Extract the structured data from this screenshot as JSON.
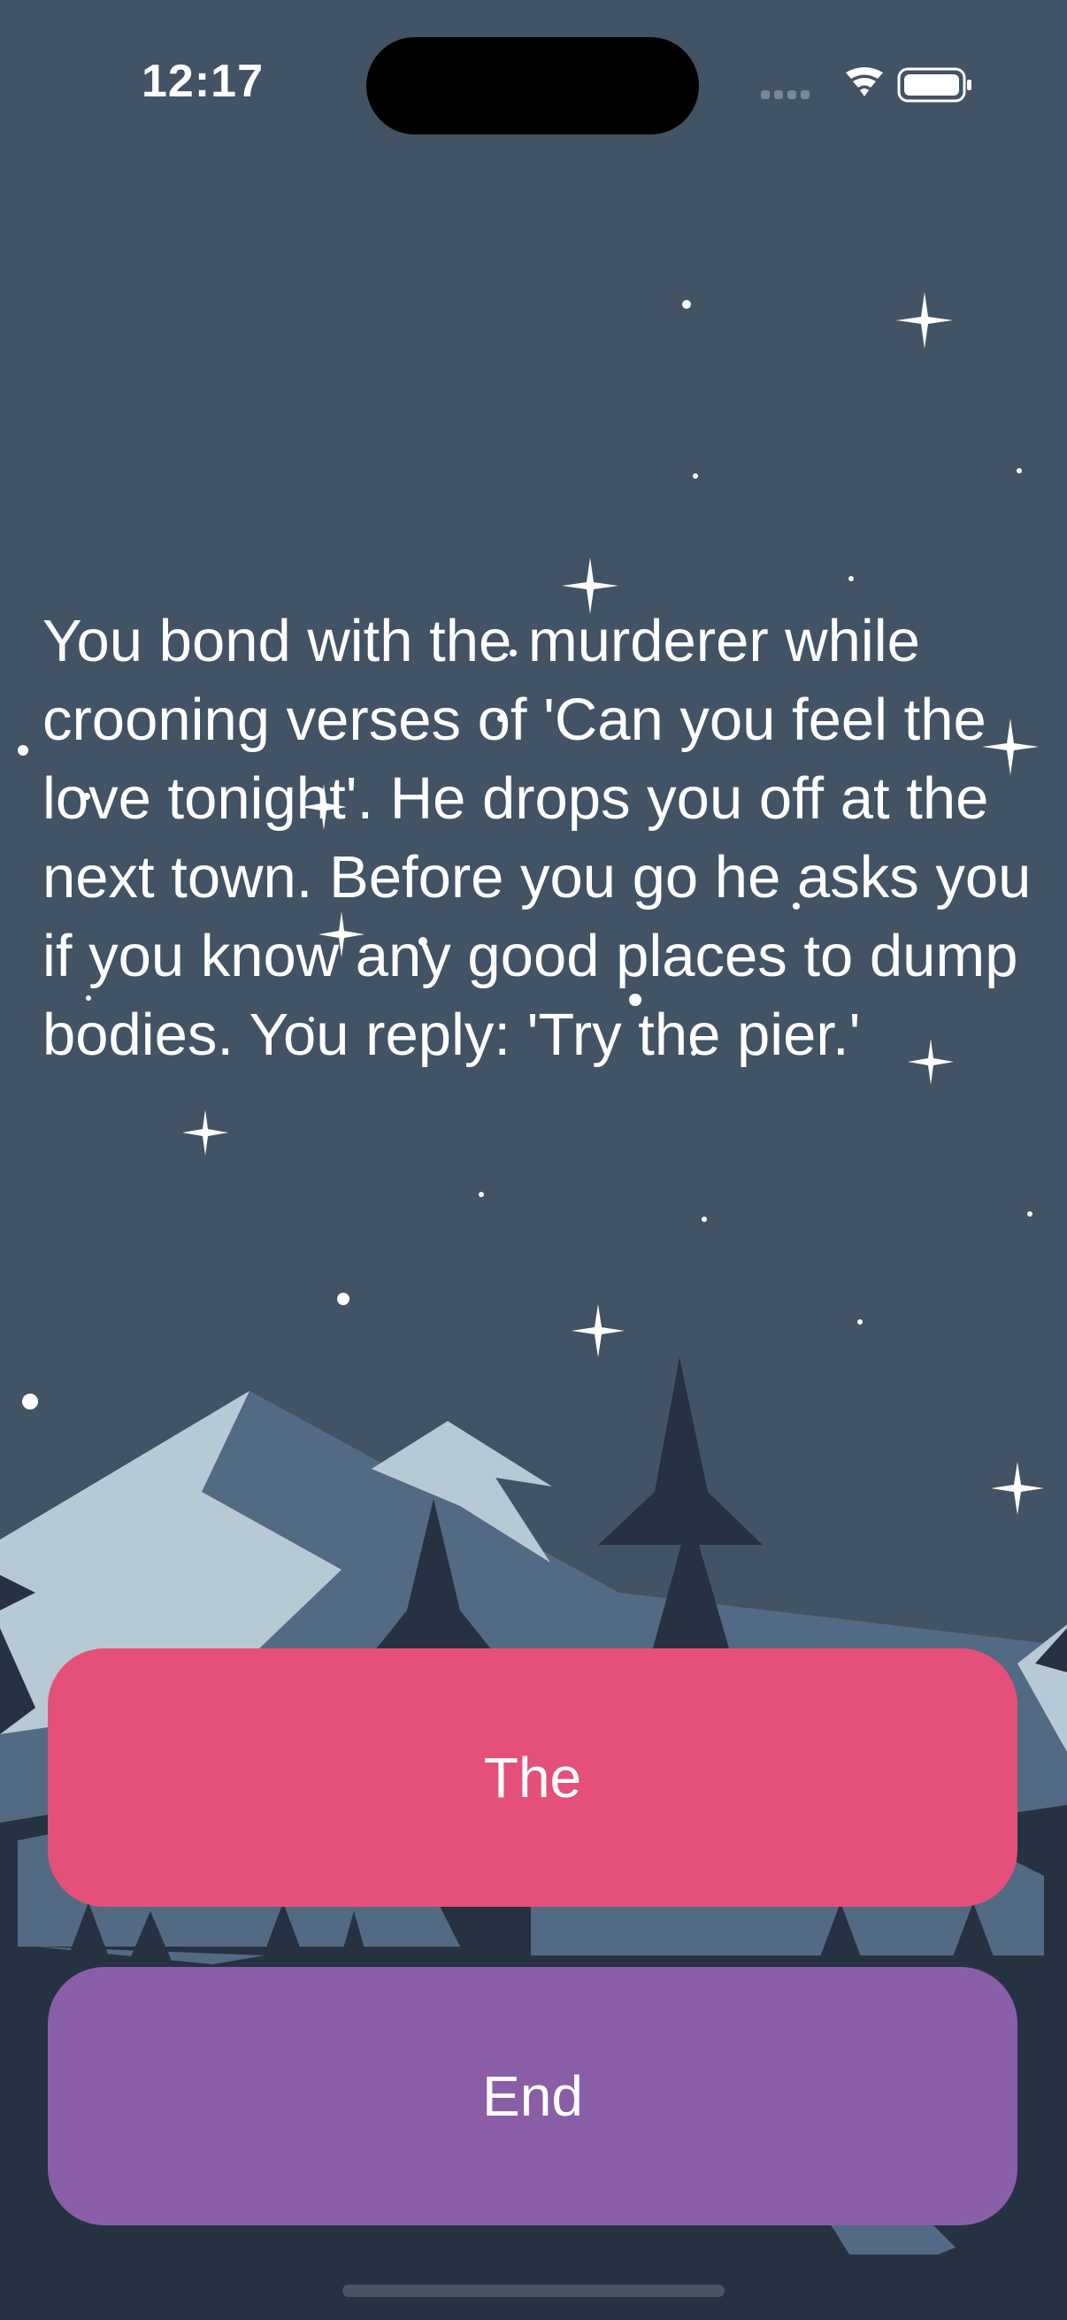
{
  "status_bar": {
    "time": "12:17",
    "icons": [
      "cellular-signal-icon",
      "wifi-icon",
      "battery-icon"
    ]
  },
  "story": {
    "text": "You bond with the murderer while crooning verses of 'Can you feel the love tonight'. He drops you off at the next town. Before you go he asks you if you know any good places to dump bodies. You reply: 'Try the pier.'"
  },
  "choices": [
    {
      "label": "The",
      "color": "#e5507a"
    },
    {
      "label": "End",
      "color": "#8a5ea6"
    }
  ],
  "colors": {
    "sky": "#415364",
    "mountain_light": "#b8c9d6",
    "mountain_mid": "#536a84",
    "trees_dark": "#263241"
  }
}
